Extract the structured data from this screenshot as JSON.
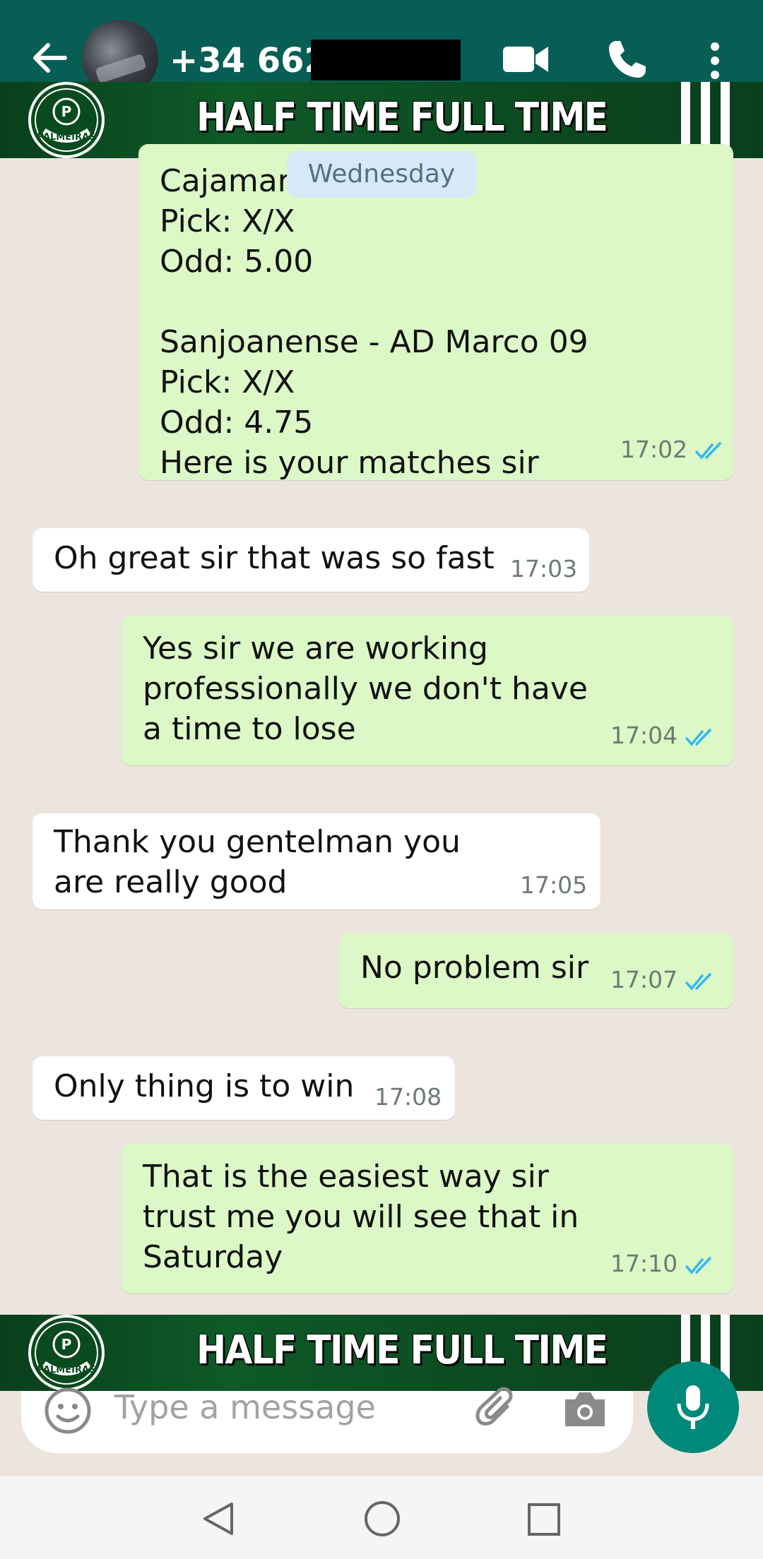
{
  "header": {
    "contact_name": "+34 662"
  },
  "banner": {
    "title": "HALF TIME FULL TIME",
    "logo_text": "PALMEIRAS"
  },
  "date_chip": "Wednesday",
  "messages": [
    {
      "direction": "outgoing",
      "text": "Cajamar           blo II\nPick: X/X\nOdd: 5.00\n\nSanjoanense - AD Marco 09\nPick: X/X\nOdd: 4.75\nHere is your matches sir",
      "time": "17:02"
    },
    {
      "direction": "incoming",
      "text": "Oh great sir that was so fast",
      "time": "17:03"
    },
    {
      "direction": "outgoing",
      "text": "Yes sir we are working\nprofessionally we don't have\na time to lose",
      "time": "17:04"
    },
    {
      "direction": "incoming",
      "text": "Thank you gentelman you\nare really good",
      "time": "17:05"
    },
    {
      "direction": "outgoing",
      "text": "No problem sir",
      "time": "17:07"
    },
    {
      "direction": "incoming",
      "text": "Only thing is to win",
      "time": "17:08"
    },
    {
      "direction": "outgoing",
      "text": "That is the easiest way sir\ntrust me you will see that in\nSaturday",
      "time": "17:10"
    }
  ],
  "composer": {
    "placeholder": "Type a message"
  },
  "colors": {
    "header": "#075e54",
    "outgoing_bubble": "#dcf8c6",
    "incoming_bubble": "#ffffff",
    "chat_background": "#ece5dd",
    "read_ticks": "#34b7f1",
    "mic_button": "#00897b",
    "banner_green": "#0e5a28"
  }
}
